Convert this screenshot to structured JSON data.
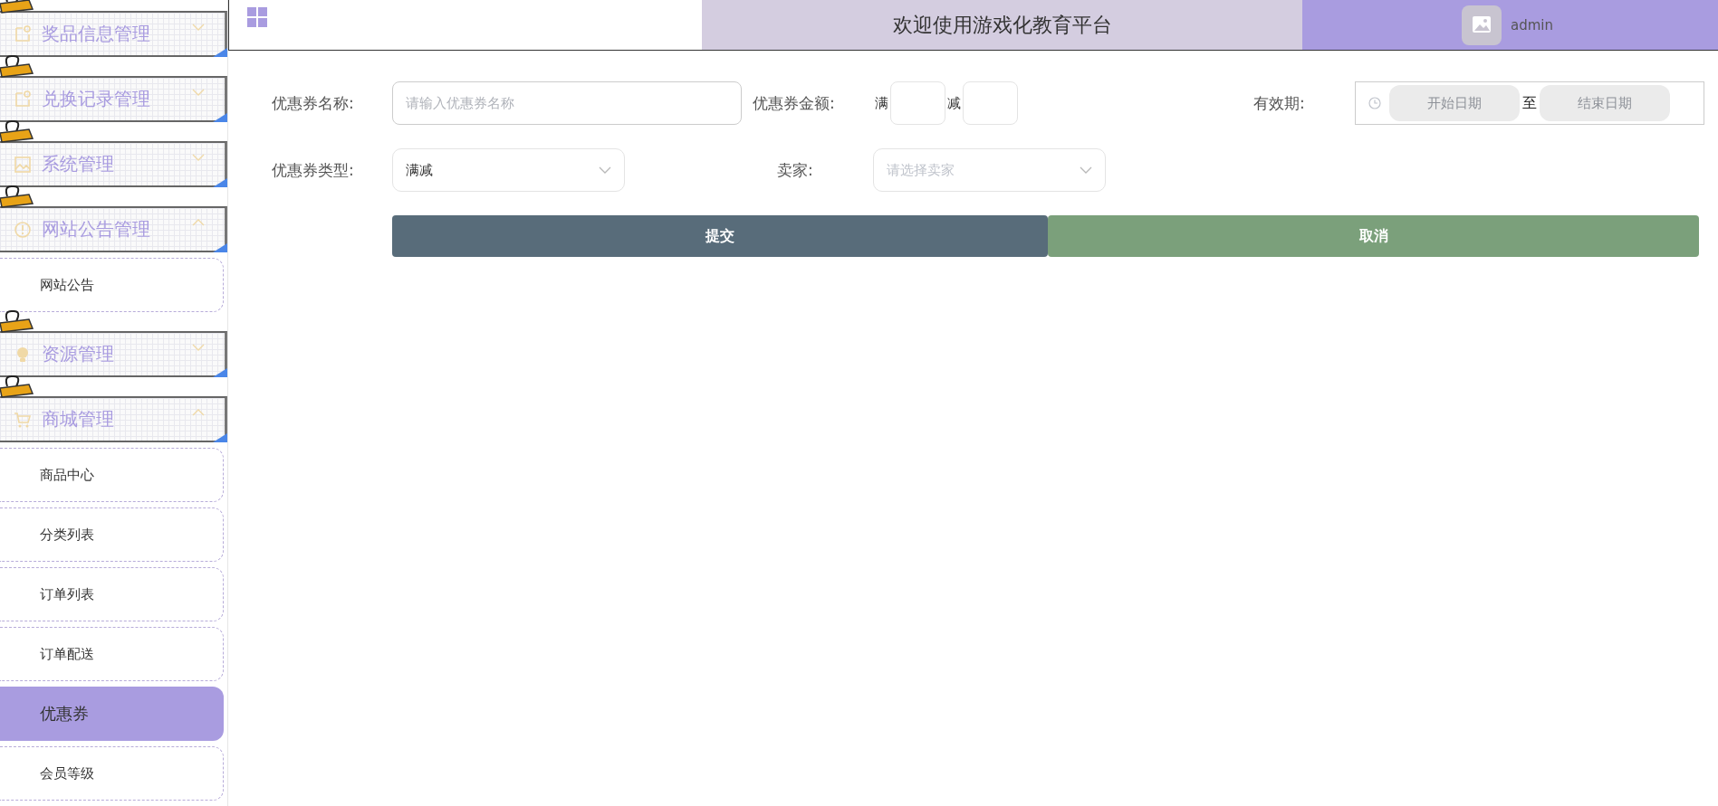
{
  "sidebar": {
    "menus": [
      {
        "title": "奖品信息管理",
        "expanded": false
      },
      {
        "title": "兑换记录管理",
        "expanded": false
      },
      {
        "title": "系统管理",
        "expanded": false
      },
      {
        "title": "网站公告管理",
        "expanded": true,
        "children": [
          {
            "label": "网站公告",
            "selected": false
          }
        ]
      },
      {
        "title": "资源管理",
        "expanded": false
      },
      {
        "title": "商城管理",
        "expanded": true,
        "children": [
          {
            "label": "商品中心",
            "selected": false
          },
          {
            "label": "分类列表",
            "selected": false
          },
          {
            "label": "订单列表",
            "selected": false
          },
          {
            "label": "订单配送",
            "selected": false
          },
          {
            "label": "优惠券",
            "selected": true
          },
          {
            "label": "会员等级",
            "selected": false
          }
        ]
      }
    ]
  },
  "header": {
    "title": "欢迎使用游戏化教育平台",
    "user": "admin"
  },
  "form": {
    "name": {
      "label": "优惠券名称:",
      "placeholder": "请输入优惠券名称"
    },
    "amount": {
      "label": "优惠券金额:",
      "full_prefix": "满",
      "reduce_prefix": "减"
    },
    "validity": {
      "label": "有效期:",
      "start_placeholder": "开始日期",
      "separator": "至",
      "end_placeholder": "结束日期"
    },
    "type": {
      "label": "优惠券类型:",
      "value": "满减"
    },
    "seller": {
      "label": "卖家:",
      "placeholder": "请选择卖家"
    },
    "buttons": [
      {
        "label": "提交",
        "kind": "submit"
      },
      {
        "label": "取消",
        "kind": "cancel"
      }
    ]
  }
}
